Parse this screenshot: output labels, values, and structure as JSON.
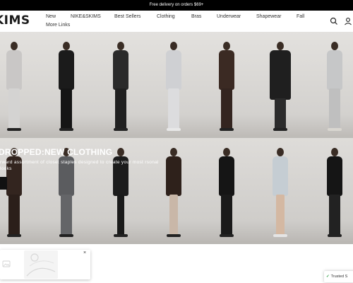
{
  "promo": {
    "text": "Free delivery on orders $69+"
  },
  "brand": {
    "logo_text": "KIMS"
  },
  "nav": {
    "items": [
      "New",
      "NIKE&SKIMS",
      "Best Sellers",
      "Clothing",
      "Bras",
      "Underwear",
      "Shapewear",
      "Fall"
    ],
    "more_label": "More Links"
  },
  "header_icons": [
    "search-icon",
    "account-icon"
  ],
  "hero": {
    "title": "DROPPED:NEW CLOTHING",
    "subtitle": "rward assortment of closet staples designed to create your most rsonal looks"
  },
  "popup": {
    "text": "",
    "close_label": "×"
  },
  "trusted_badge": {
    "label": "Trusted S"
  },
  "colors": {
    "promo_bg": "#000000",
    "text": "#111111",
    "trusted_check": "#2e9e44"
  }
}
